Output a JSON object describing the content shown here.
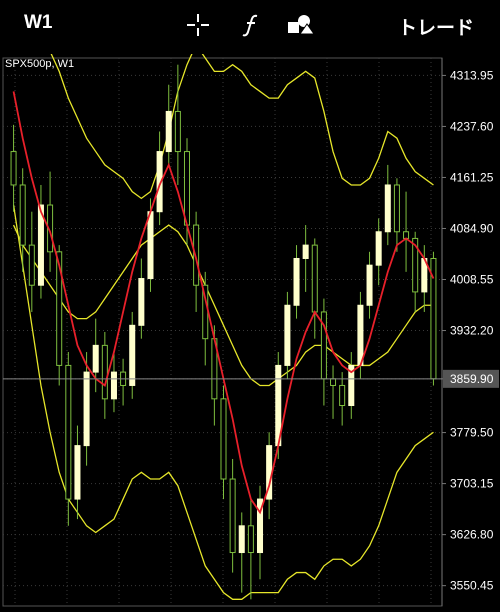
{
  "header": {
    "timeframe": "W1",
    "trade_label": "トレード",
    "icons": [
      "crosshair-icon",
      "function-icon",
      "objects-icon"
    ]
  },
  "chart": {
    "symbol_label": "SPX500p, W1",
    "price_labels": [
      "4313.95",
      "4237.60",
      "4161.25",
      "4084.90",
      "4008.55",
      "3932.20",
      "3859.90",
      "3779.50",
      "3703.15",
      "3626.80",
      "3550.45"
    ],
    "current_price": "3859.90",
    "colors": {
      "background": "#000000",
      "bull_candle": "#ffffcc",
      "wick": "#7fbf3f",
      "ma": "#e8202a",
      "bands": "#e6e62a",
      "grid": "#3a3a3a",
      "axis_text": "#ffffff"
    }
  },
  "chart_data": {
    "type": "candlestick",
    "indicators": [
      "moving-average",
      "envelope-bands"
    ],
    "yaxis": {
      "min": 3520,
      "max": 4340,
      "ticks": [
        4313.95,
        4237.6,
        4161.25,
        4084.9,
        4008.55,
        3932.2,
        3859.9,
        3779.5,
        3703.15,
        3626.8,
        3550.45
      ]
    },
    "candles": [
      {
        "o": 4200,
        "h": 4240,
        "c": 4150,
        "l": 4110
      },
      {
        "o": 4150,
        "h": 4175,
        "c": 4060,
        "l": 4020
      },
      {
        "o": 4060,
        "h": 4110,
        "c": 4000,
        "l": 3960
      },
      {
        "o": 4000,
        "h": 4150,
        "c": 4120,
        "l": 3980
      },
      {
        "o": 4120,
        "h": 4170,
        "c": 4050,
        "l": 4020
      },
      {
        "o": 4050,
        "h": 4060,
        "c": 3880,
        "l": 3850
      },
      {
        "o": 3880,
        "h": 3900,
        "c": 3680,
        "l": 3640
      },
      {
        "o": 3680,
        "h": 3790,
        "c": 3760,
        "l": 3650
      },
      {
        "o": 3760,
        "h": 3900,
        "c": 3870,
        "l": 3730
      },
      {
        "o": 3870,
        "h": 3950,
        "c": 3910,
        "l": 3840
      },
      {
        "o": 3910,
        "h": 3930,
        "c": 3830,
        "l": 3800
      },
      {
        "o": 3830,
        "h": 3900,
        "c": 3870,
        "l": 3810
      },
      {
        "o": 3870,
        "h": 3890,
        "c": 3850,
        "l": 3820
      },
      {
        "o": 3850,
        "h": 3960,
        "c": 3940,
        "l": 3830
      },
      {
        "o": 3940,
        "h": 4040,
        "c": 4010,
        "l": 3920
      },
      {
        "o": 4010,
        "h": 4130,
        "c": 4110,
        "l": 3990
      },
      {
        "o": 4110,
        "h": 4230,
        "c": 4200,
        "l": 4090
      },
      {
        "o": 4200,
        "h": 4300,
        "c": 4260,
        "l": 4180
      },
      {
        "o": 4260,
        "h": 4330,
        "c": 4200,
        "l": 4150
      },
      {
        "o": 4200,
        "h": 4220,
        "c": 4090,
        "l": 4060
      },
      {
        "o": 4090,
        "h": 4110,
        "c": 4000,
        "l": 3960
      },
      {
        "o": 4000,
        "h": 4020,
        "c": 3920,
        "l": 3880
      },
      {
        "o": 3920,
        "h": 3940,
        "c": 3830,
        "l": 3790
      },
      {
        "o": 3830,
        "h": 3850,
        "c": 3710,
        "l": 3680
      },
      {
        "o": 3710,
        "h": 3740,
        "c": 3600,
        "l": 3570
      },
      {
        "o": 3600,
        "h": 3660,
        "c": 3640,
        "l": 3540
      },
      {
        "o": 3640,
        "h": 3680,
        "c": 3600,
        "l": 3530
      },
      {
        "o": 3600,
        "h": 3700,
        "c": 3680,
        "l": 3560
      },
      {
        "o": 3680,
        "h": 3780,
        "c": 3760,
        "l": 3650
      },
      {
        "o": 3760,
        "h": 3900,
        "c": 3880,
        "l": 3740
      },
      {
        "o": 3880,
        "h": 3990,
        "c": 3970,
        "l": 3860
      },
      {
        "o": 3970,
        "h": 4060,
        "c": 4040,
        "l": 3950
      },
      {
        "o": 4040,
        "h": 4090,
        "c": 4060,
        "l": 3990
      },
      {
        "o": 4060,
        "h": 4070,
        "c": 3960,
        "l": 3920
      },
      {
        "o": 3960,
        "h": 3980,
        "c": 3860,
        "l": 3820
      },
      {
        "o": 3860,
        "h": 3880,
        "c": 3850,
        "l": 3800
      },
      {
        "o": 3850,
        "h": 3870,
        "c": 3820,
        "l": 3790
      },
      {
        "o": 3820,
        "h": 3900,
        "c": 3880,
        "l": 3800
      },
      {
        "o": 3880,
        "h": 3990,
        "c": 3970,
        "l": 3860
      },
      {
        "o": 3970,
        "h": 4050,
        "c": 4030,
        "l": 3950
      },
      {
        "o": 4030,
        "h": 4100,
        "c": 4080,
        "l": 4000
      },
      {
        "o": 4080,
        "h": 4180,
        "c": 4150,
        "l": 4060
      },
      {
        "o": 4150,
        "h": 4160,
        "c": 4080,
        "l": 4050
      },
      {
        "o": 4080,
        "h": 4140,
        "c": 4070,
        "l": 4020
      },
      {
        "o": 4070,
        "h": 4080,
        "c": 3990,
        "l": 3960
      },
      {
        "o": 3990,
        "h": 4060,
        "c": 4040,
        "l": 3960
      },
      {
        "o": 4040,
        "h": 4050,
        "c": 3860,
        "l": 3850
      }
    ],
    "ma_values": [
      4290,
      4220,
      4160,
      4110,
      4080,
      4030,
      3970,
      3910,
      3880,
      3860,
      3850,
      3900,
      3960,
      4020,
      4070,
      4110,
      4150,
      4180,
      4140,
      4090,
      4040,
      3980,
      3920,
      3860,
      3800,
      3730,
      3680,
      3660,
      3700,
      3760,
      3830,
      3890,
      3930,
      3960,
      3940,
      3900,
      3880,
      3870,
      3880,
      3920,
      3970,
      4020,
      4060,
      4070,
      4060,
      4040,
      4010
    ],
    "upper_band": [
      4440,
      4420,
      4400,
      4380,
      4350,
      4320,
      4280,
      4250,
      4220,
      4200,
      4180,
      4170,
      4160,
      4140,
      4130,
      4140,
      4180,
      4230,
      4290,
      4330,
      4360,
      4340,
      4320,
      4320,
      4330,
      4320,
      4300,
      4290,
      4280,
      4280,
      4300,
      4310,
      4320,
      4310,
      4260,
      4200,
      4160,
      4150,
      4150,
      4160,
      4190,
      4230,
      4220,
      4190,
      4170,
      4160,
      4150
    ],
    "lower_band": [
      4120,
      4030,
      3940,
      3850,
      3780,
      3720,
      3680,
      3660,
      3640,
      3630,
      3640,
      3650,
      3680,
      3710,
      3720,
      3710,
      3710,
      3720,
      3700,
      3660,
      3620,
      3580,
      3560,
      3540,
      3530,
      3530,
      3540,
      3540,
      3540,
      3540,
      3560,
      3570,
      3570,
      3560,
      3580,
      3590,
      3590,
      3580,
      3590,
      3610,
      3640,
      3680,
      3720,
      3740,
      3760,
      3770,
      3780
    ],
    "lower_ma": [
      4090,
      4060,
      4040,
      4020,
      4000,
      3980,
      3960,
      3950,
      3950,
      3960,
      3980,
      4000,
      4020,
      4040,
      4060,
      4070,
      4080,
      4090,
      4080,
      4060,
      4030,
      4000,
      3970,
      3940,
      3910,
      3880,
      3860,
      3850,
      3850,
      3860,
      3870,
      3880,
      3900,
      3910,
      3910,
      3900,
      3890,
      3880,
      3880,
      3880,
      3890,
      3900,
      3920,
      3940,
      3960,
      3970,
      3970
    ]
  }
}
